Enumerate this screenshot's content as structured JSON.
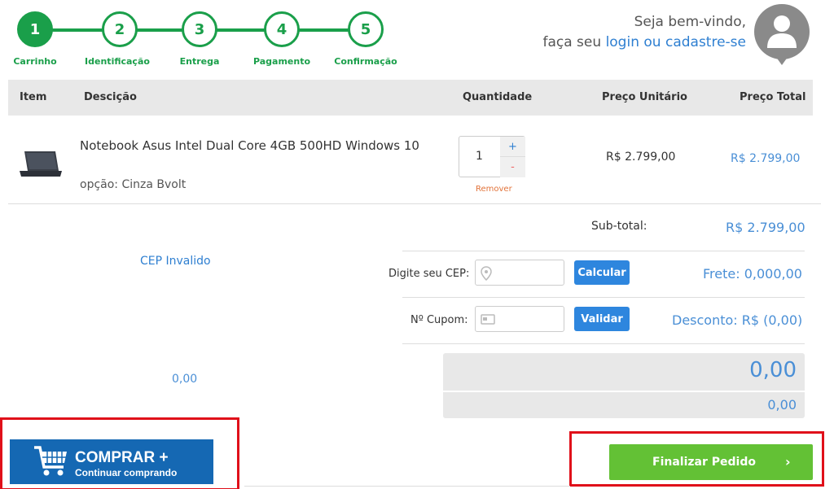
{
  "steps": [
    {
      "number": "1",
      "label": "Carrinho"
    },
    {
      "number": "2",
      "label": "Identificação"
    },
    {
      "number": "3",
      "label": "Entrega"
    },
    {
      "number": "4",
      "label": "Pagamento"
    },
    {
      "number": "5",
      "label": "Confirmação"
    }
  ],
  "welcome": {
    "line1": "Seja bem-vindo,",
    "prefix": "faça seu ",
    "login": "login",
    "sep": " ou ",
    "signup": "cadastre-se"
  },
  "table": {
    "col_item": "Item",
    "col_desc": "Descição",
    "col_qty": "Quantidade",
    "col_unit": "Preço Unitário",
    "col_total": "Preço Total"
  },
  "product": {
    "name": "Notebook Asus Intel Dual Core 4GB 500HD Windows 10",
    "option": "opção: Cinza Bvolt",
    "quantity": "1",
    "plus": "+",
    "minus": "-",
    "remove": "Remover",
    "unit_price": "R$ 2.799,00",
    "total_price": "R$ 2.799,00"
  },
  "summary": {
    "subtotal_label": "Sub-total:",
    "subtotal_value": "R$ 2.799,00",
    "cep_invalid": "CEP Invalido",
    "cep_label": "Digite seu CEP:",
    "cep_placeholder": "",
    "calc_button": "Calcular",
    "frete": "Frete: 0,000,00",
    "coupon_label": "Nº Cupom:",
    "coupon_placeholder": "",
    "validate_button": "Validar",
    "desconto": "Desconto: R$ (0,00)",
    "total_big": "0,00",
    "total_small": "0,00",
    "left_value": "0,00"
  },
  "buttons": {
    "comprar_title": "COMPRAR +",
    "comprar_sub": "Continuar comprando",
    "finalizar": "Finalizar Pedido",
    "finalizar_chevron": "›"
  },
  "colors": {
    "green": "#1a9f4a",
    "blue": "#2e86de",
    "highlight": "#e0101a",
    "finalize": "#63c135"
  }
}
